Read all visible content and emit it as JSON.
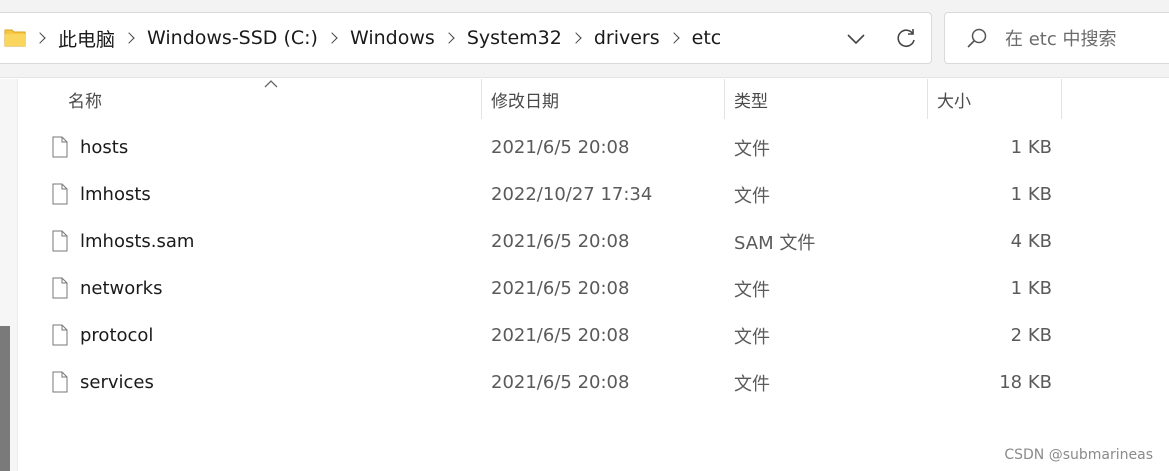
{
  "address": {
    "crumbs": [
      "此电脑",
      "Windows-SSD (C:)",
      "Windows",
      "System32",
      "drivers",
      "etc"
    ]
  },
  "search": {
    "placeholder": "在 etc 中搜索"
  },
  "columns": {
    "name": "名称",
    "date": "修改日期",
    "type": "类型",
    "size": "大小"
  },
  "files": [
    {
      "name": "hosts",
      "date": "2021/6/5 20:08",
      "type": "文件",
      "size": "1 KB"
    },
    {
      "name": "lmhosts",
      "date": "2022/10/27 17:34",
      "type": "文件",
      "size": "1 KB"
    },
    {
      "name": "lmhosts.sam",
      "date": "2021/6/5 20:08",
      "type": "SAM 文件",
      "size": "4 KB"
    },
    {
      "name": "networks",
      "date": "2021/6/5 20:08",
      "type": "文件",
      "size": "1 KB"
    },
    {
      "name": "protocol",
      "date": "2021/6/5 20:08",
      "type": "文件",
      "size": "2 KB"
    },
    {
      "name": "services",
      "date": "2021/6/5 20:08",
      "type": "文件",
      "size": "18 KB"
    }
  ],
  "watermark": "CSDN @submarineas",
  "colors": {
    "folder": "#f7c744",
    "background": "#ffffff",
    "chrome": "#f3f3f3"
  }
}
